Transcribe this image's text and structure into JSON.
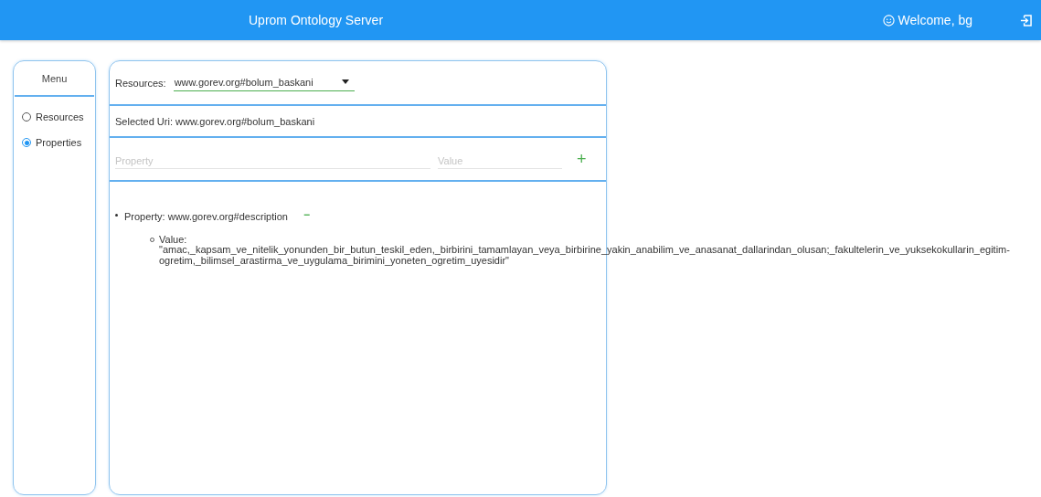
{
  "header": {
    "title": "Uprom Ontology Server",
    "welcome": "Welcome, bg"
  },
  "menu": {
    "title": "Menu",
    "items": [
      {
        "label": "Resources",
        "selected": false
      },
      {
        "label": "Properties",
        "selected": true
      }
    ]
  },
  "resources": {
    "label": "Resources:",
    "value": "www.gorev.org#bolum_baskani"
  },
  "selected_uri": "Selected Uri: www.gorev.org#bolum_baskani",
  "new_property": {
    "property_placeholder": "Property",
    "value_placeholder": "Value",
    "add": "+"
  },
  "properties": [
    {
      "property": "Property: www.gorev.org#description",
      "remove": "−",
      "values": [
        {
          "label": "Value:",
          "text": "\"amac,_kapsam_ve_nitelik_yonunden_bir_butun_teskil_eden,_birbirini_tamamlayan_veya_birbirine_yakin_anabilim_ve_anasanat_dallarindan_olusan;_fakultelerin_ve_yuksekokullarin_egitim-ogretim,_bilimsel_arastirma_ve_uygulama_birimini_yoneten_ogretim_uyesidir\""
        }
      ]
    }
  ]
}
